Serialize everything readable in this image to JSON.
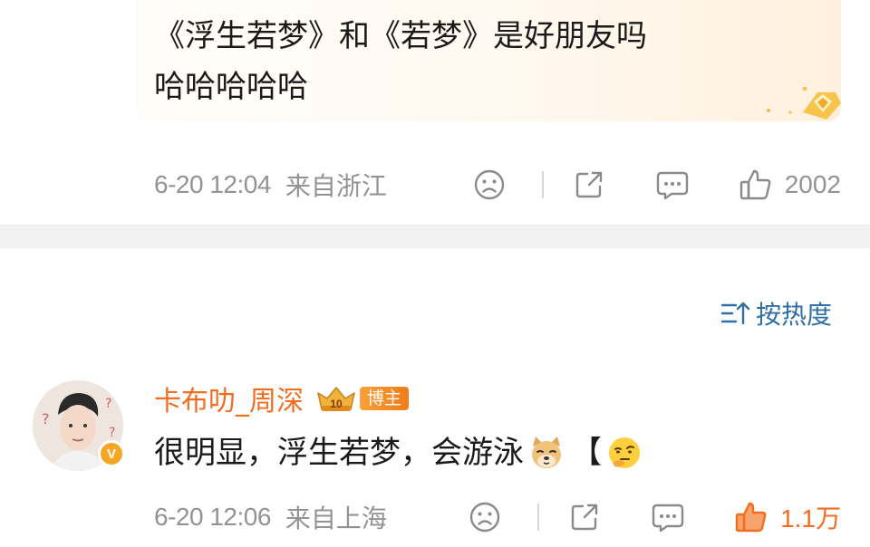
{
  "comment_top": {
    "text_line1": "《浮生若梦》和《若梦》是好朋友吗",
    "text_line2": "哈哈哈哈哈",
    "time": "6-20 12:04",
    "location": "来自浙江",
    "like_count": "2002"
  },
  "sort": {
    "label": "按热度"
  },
  "comment_second": {
    "username": "卡布叻_周深",
    "level": "10",
    "tag": "博主",
    "verified_mark": "V",
    "text": "很明显，浮生若梦，会游泳",
    "bracket": "【",
    "time": "6-20 12:06",
    "location": "来自上海",
    "like_count": "1.1万"
  },
  "colors": {
    "username": "#f26d1f",
    "meta_gray": "#939393",
    "sort_blue": "#2f6fa6",
    "liked_orange": "#f26d1f"
  },
  "icons": {
    "dislike": "sad-face-icon",
    "share": "share-icon",
    "reply": "comment-icon",
    "like": "thumbs-up-icon",
    "sort": "sort-icon"
  }
}
